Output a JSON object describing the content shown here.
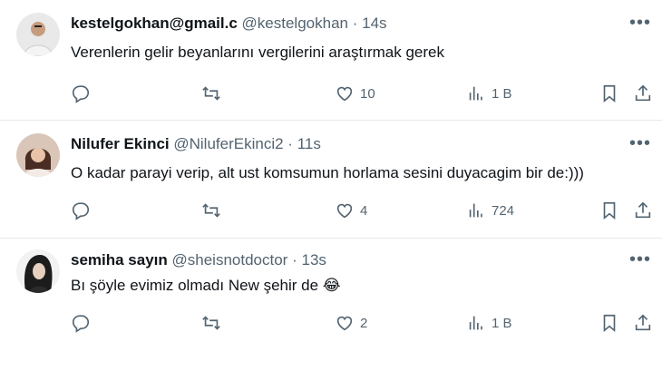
{
  "tweets": [
    {
      "name": "kestelgokhan@gmail.c",
      "handle": "@kestelgokhan",
      "dot": "·",
      "time": "14s",
      "text": "Verenlerin gelir beyanlarını vergilerini araştırmak gerek",
      "likes": "10",
      "views": "1 B",
      "avatar_color": "#d8d8d8"
    },
    {
      "name": "Nilufer Ekinci",
      "handle": "@NiluferEkinci2",
      "dot": "·",
      "time": "11s",
      "text": "O kadar parayi verip, alt ust komsumun horlama sesini duyacagim bir de:)))",
      "likes": "4",
      "views": "724",
      "avatar_color": "#6b4a3a"
    },
    {
      "name": "semiha sayın",
      "handle": "@sheisnotdoctor",
      "dot": "·",
      "time": "13s",
      "text": "Bı şöyle evimiz olmadı New şehir de 😂",
      "likes": "2",
      "views": "1 B",
      "avatar_color": "#2a2a2a"
    }
  ],
  "icons": {
    "more": "more-icon",
    "reply": "reply-icon",
    "retweet": "retweet-icon",
    "like": "like-icon",
    "views": "views-icon",
    "bookmark": "bookmark-icon",
    "share": "share-icon"
  },
  "colors": {
    "text": "#0f1419",
    "muted": "#536471",
    "divider": "#e6e9ec"
  }
}
